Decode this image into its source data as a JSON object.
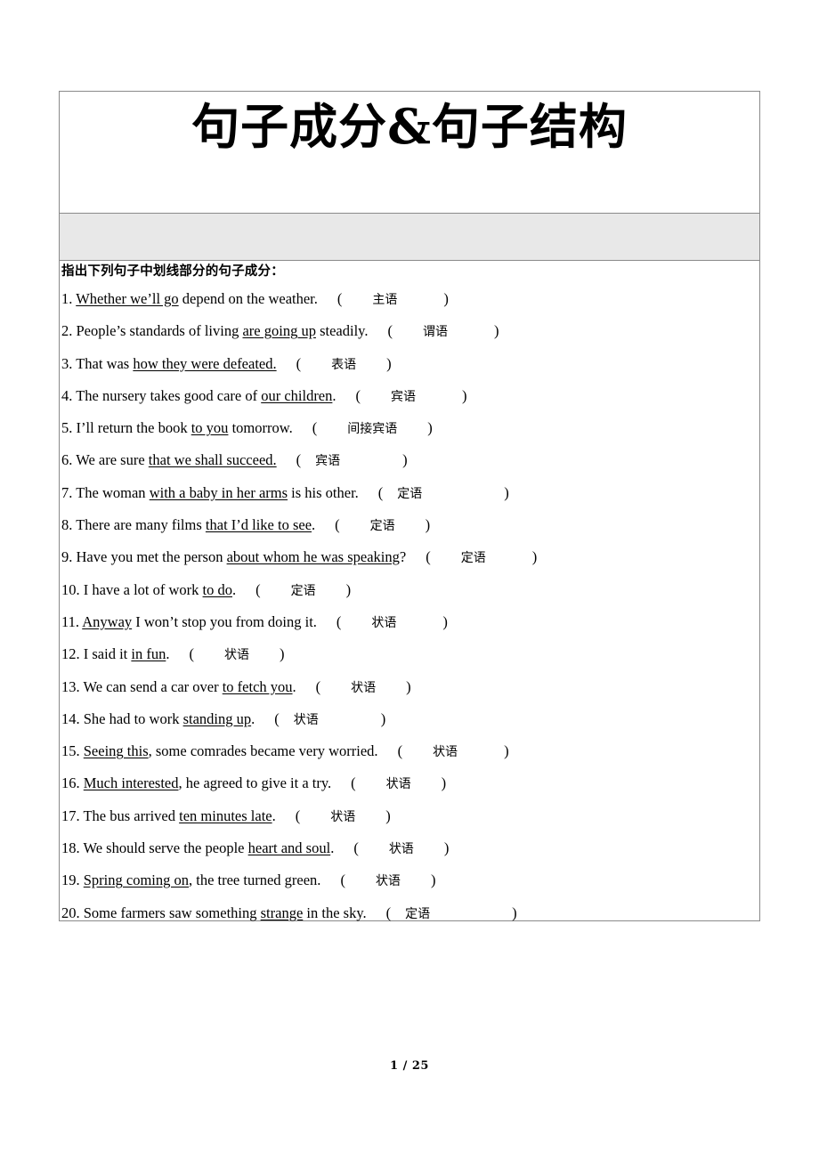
{
  "document": {
    "title": "句子成分&句子结构",
    "instruction": "指出下列句子中划线部分的句子成分：",
    "footer": "1 / 25"
  },
  "colors": {
    "border": "#8a8a8a",
    "band_background": "#e8e8e8",
    "text": "#000000",
    "page_background": "#ffffff"
  },
  "questions": [
    {
      "number": "1.",
      "before": "",
      "underlined": "Whether we’ll go",
      "after": " depend on the weather.",
      "answer": "主语",
      "open_paren": "(",
      "close_paren": ")",
      "lead_gap": "gap-md",
      "trail_gap": "gap-lg"
    },
    {
      "number": "2.",
      "before": "People’s standards of living ",
      "underlined": "are going up",
      "after": " steadily.",
      "answer": "谓语",
      "open_paren": "(",
      "close_paren": ")",
      "lead_gap": "gap-md",
      "trail_gap": "gap-lg"
    },
    {
      "number": "3.",
      "before": "That was ",
      "underlined": "how they were defeated.",
      "after": "",
      "answer": "表语",
      "open_paren": "(",
      "close_paren": ")",
      "lead_gap": "gap-md",
      "trail_gap": "gap-md"
    },
    {
      "number": "4.",
      "before": "The nursery takes good care of ",
      "underlined": "our children",
      "after": ".",
      "answer": "宾语",
      "open_paren": "(",
      "close_paren": ")",
      "lead_gap": "gap-md",
      "trail_gap": "gap-lg"
    },
    {
      "number": "5.",
      "before": "I’ll return the book ",
      "underlined": "to you",
      "after": " tomorrow.",
      "answer": "间接宾语",
      "open_paren": "(",
      "close_paren": ")",
      "lead_gap": "gap-md",
      "trail_gap": "gap-md"
    },
    {
      "number": "6.",
      "before": "We are sure ",
      "underlined": "that we shall succeed.",
      "after": "",
      "answer": "宾语",
      "open_paren": "(",
      "close_paren": ")",
      "lead_gap": "gap-sm",
      "trail_gap": "gap-xl"
    },
    {
      "number": "7.",
      "before": "The woman ",
      "underlined": "with a baby in her arms",
      "after": " is his other.",
      "answer": "定语",
      "open_paren": "(",
      "close_paren": ")",
      "lead_gap": "gap-sm",
      "trail_gap": "gap-xxl"
    },
    {
      "number": "8.",
      "before": "There are many films ",
      "underlined": "that I’d like to see",
      "after": ".",
      "answer": "定语",
      "open_paren": "(",
      "close_paren": ")",
      "lead_gap": "gap-md",
      "trail_gap": "gap-md"
    },
    {
      "number": "9.",
      "before": "Have you met the person ",
      "underlined": "about whom he was speaking",
      "after": "?",
      "answer": "定语",
      "open_paren": "(",
      "close_paren": ")",
      "lead_gap": "gap-md",
      "trail_gap": "gap-lg"
    },
    {
      "number": "10.",
      "before": "I have a lot of work ",
      "underlined": "to do",
      "after": ".",
      "answer": "定语",
      "open_paren": "(",
      "close_paren": ")",
      "lead_gap": "gap-md",
      "trail_gap": "gap-md"
    },
    {
      "number": "11.",
      "before": "",
      "underlined": "Anyway",
      "after": " I won’t stop you from doing it.",
      "answer": "状语",
      "open_paren": "(",
      "close_paren": ")",
      "lead_gap": "gap-md",
      "trail_gap": "gap-lg"
    },
    {
      "number": "12.",
      "before": "I said it ",
      "underlined": "in fun",
      "after": ".",
      "answer": "状语",
      "open_paren": "(",
      "close_paren": ")",
      "lead_gap": "gap-md",
      "trail_gap": "gap-md"
    },
    {
      "number": "13.",
      "before": "We can send a car over ",
      "underlined": "to fetch you",
      "after": ".",
      "answer": "状语",
      "open_paren": "(",
      "close_paren": ")",
      "lead_gap": "gap-md",
      "trail_gap": "gap-md"
    },
    {
      "number": "14.",
      "before": "She had to work ",
      "underlined": "standing up",
      "after": ".",
      "answer": "状语",
      "open_paren": "(",
      "close_paren": ")",
      "lead_gap": "gap-sm",
      "trail_gap": "gap-xl"
    },
    {
      "number": "15.",
      "before": "",
      "underlined": "Seeing this",
      "after": ", some comrades became very worried.",
      "answer": "状语",
      "open_paren": "(",
      "close_paren": ")",
      "lead_gap": "gap-md",
      "trail_gap": "gap-lg"
    },
    {
      "number": "16.",
      "before": "",
      "underlined": "Much interested",
      "after": ", he agreed to give it a try.",
      "answer": "状语",
      "open_paren": "(",
      "close_paren": ")",
      "lead_gap": "gap-md",
      "trail_gap": "gap-md"
    },
    {
      "number": "17.",
      "before": "The bus arrived ",
      "underlined": "ten minutes late",
      "after": ".",
      "answer": "状语",
      "open_paren": "(",
      "close_paren": ")",
      "lead_gap": "gap-md",
      "trail_gap": "gap-md"
    },
    {
      "number": "18.",
      "before": "We should serve the people ",
      "underlined": "heart and soul",
      "after": ".",
      "answer": "状语",
      "open_paren": "(",
      "close_paren": ")",
      "lead_gap": "gap-md",
      "trail_gap": "gap-md"
    },
    {
      "number": "19.",
      "before": "",
      "underlined": "Spring coming on",
      "after": ", the tree turned green.",
      "answer": "状语",
      "open_paren": "(",
      "close_paren": ")",
      "lead_gap": "gap-md",
      "trail_gap": "gap-md"
    },
    {
      "number": "20.",
      "before": "Some farmers saw something ",
      "underlined": "strange",
      "after": " in the sky.",
      "answer": "定语",
      "open_paren": "(",
      "close_paren": ")",
      "lead_gap": "gap-sm",
      "trail_gap": "gap-xxl"
    }
  ]
}
